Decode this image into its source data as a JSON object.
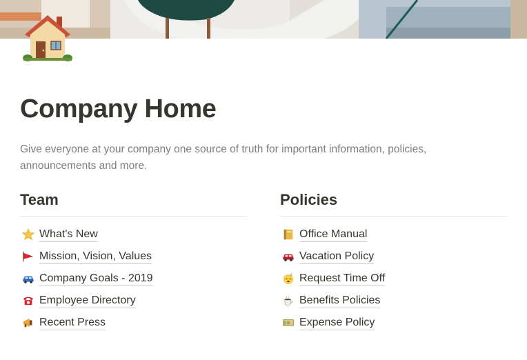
{
  "page": {
    "icon": "house-icon",
    "title": "Company Home",
    "description": "Give everyone at your company one source of truth for important information, policies, announcements and more."
  },
  "sections": [
    {
      "heading": "Team",
      "links": [
        {
          "icon": "star-icon",
          "label": "What's New"
        },
        {
          "icon": "flag-icon",
          "label": "Mission, Vision, Values"
        },
        {
          "icon": "car-icon",
          "label": "Company Goals - 2019"
        },
        {
          "icon": "telephone-icon",
          "label": "Employee Directory"
        },
        {
          "icon": "megaphone-icon",
          "label": "Recent Press"
        }
      ]
    },
    {
      "heading": "Policies",
      "links": [
        {
          "icon": "notebook-icon",
          "label": "Office Manual"
        },
        {
          "icon": "red-car-icon",
          "label": "Vacation Policy"
        },
        {
          "icon": "sleeping-face-icon",
          "label": "Request Time Off"
        },
        {
          "icon": "coffee-icon",
          "label": "Benefits Policies"
        },
        {
          "icon": "money-icon",
          "label": "Expense Policy"
        }
      ]
    }
  ],
  "colors": {
    "text": "#37352f",
    "muted_text": "#7a7872",
    "divider": "#e6e6e4",
    "cover_floor": "#d8d5d0",
    "cover_chair_dark": "#1f4a44",
    "cover_chair_light": "#e9e9e9",
    "cover_sofa": "#9fb0be"
  }
}
